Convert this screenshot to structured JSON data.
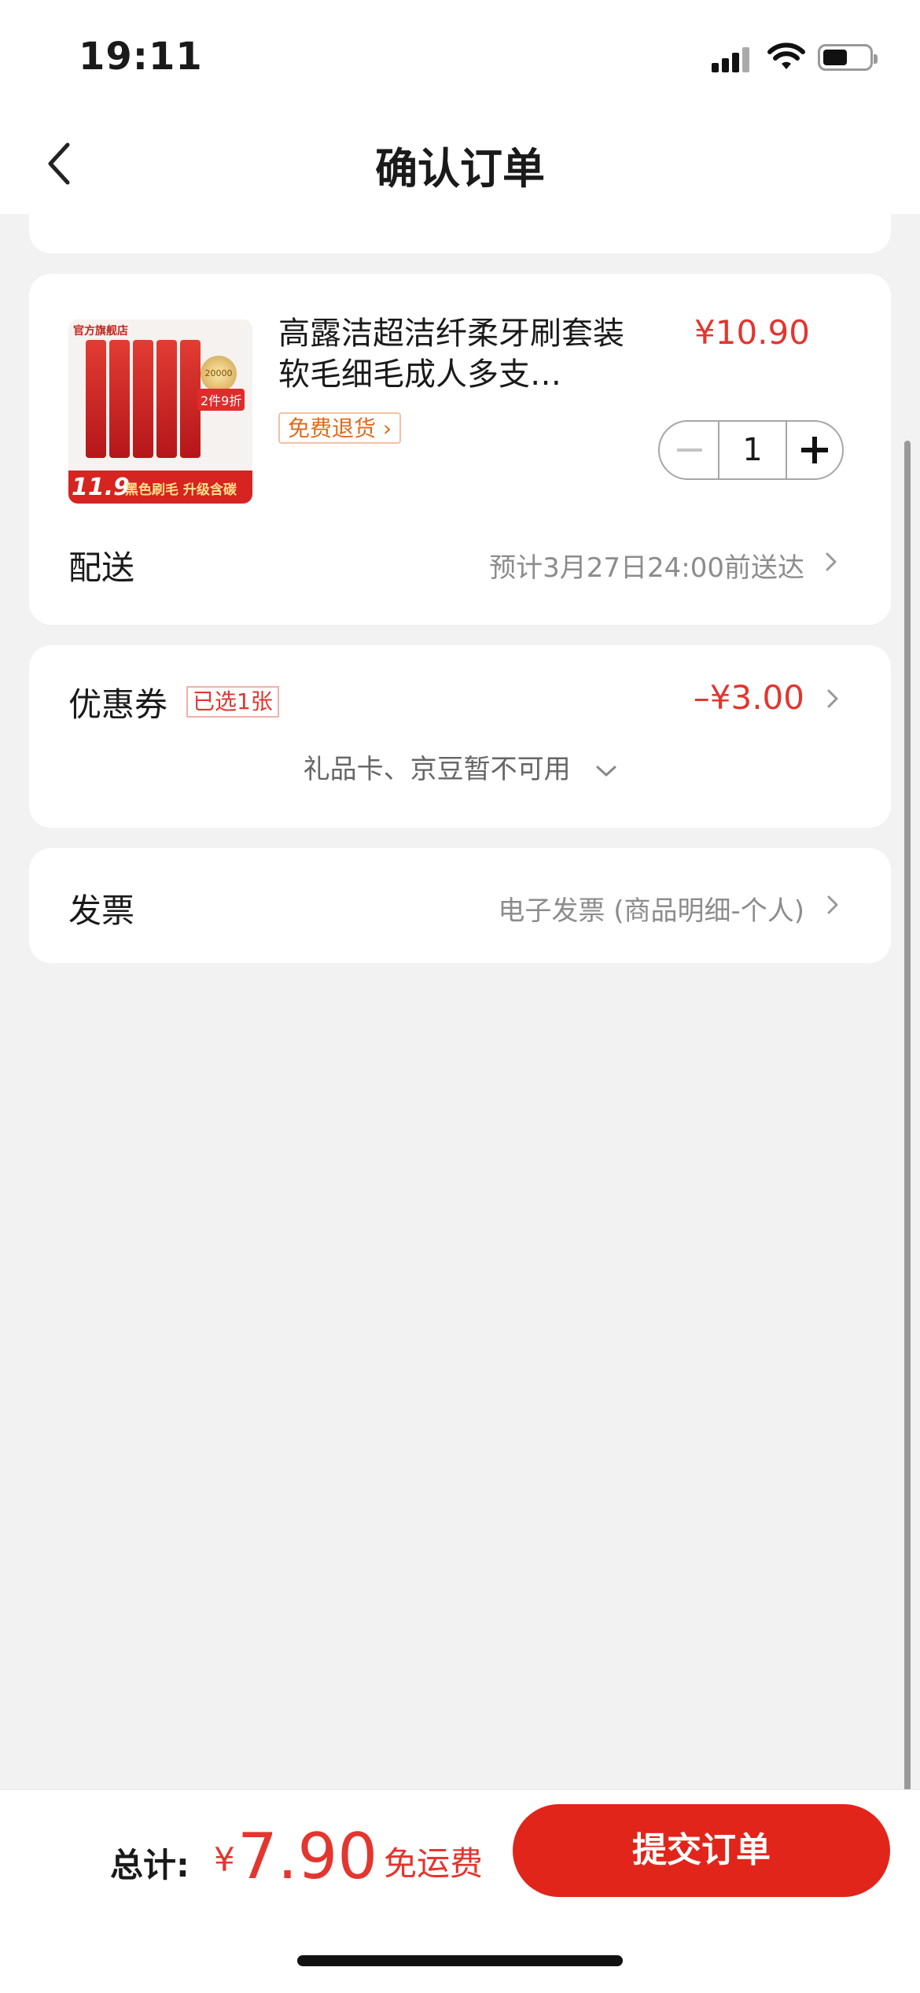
{
  "status_bar": {
    "time": "19:11"
  },
  "nav": {
    "title": "确认订单"
  },
  "product": {
    "thumb": {
      "shop_label": "官方旗舰店",
      "promo_badge": "2件9折",
      "seal": "20000",
      "price": "11.9",
      "banner": "黑色刷毛 升级含碳"
    },
    "name": "高露洁超洁纤柔牙刷套装软毛细毛成人多支…",
    "return_tag": "免费退货",
    "price": "¥10.90",
    "quantity": "1"
  },
  "delivery": {
    "label": "配送",
    "value": "预计3月27日24:00前送达"
  },
  "coupon": {
    "label": "优惠券",
    "selected_tag": "已选1张",
    "amount": "–¥3.00",
    "gift_note": "礼品卡、京豆暂不可用"
  },
  "invoice": {
    "label": "发票",
    "value": "电子发票 (商品明细-个人)"
  },
  "footer": {
    "total_label": "总计:",
    "currency": "¥",
    "total_value": "7.90",
    "shipping": "免运费",
    "submit_label": "提交订单"
  },
  "colors": {
    "accent": "#e1251b",
    "price": "#e2362f",
    "background": "#f2f2f2"
  }
}
